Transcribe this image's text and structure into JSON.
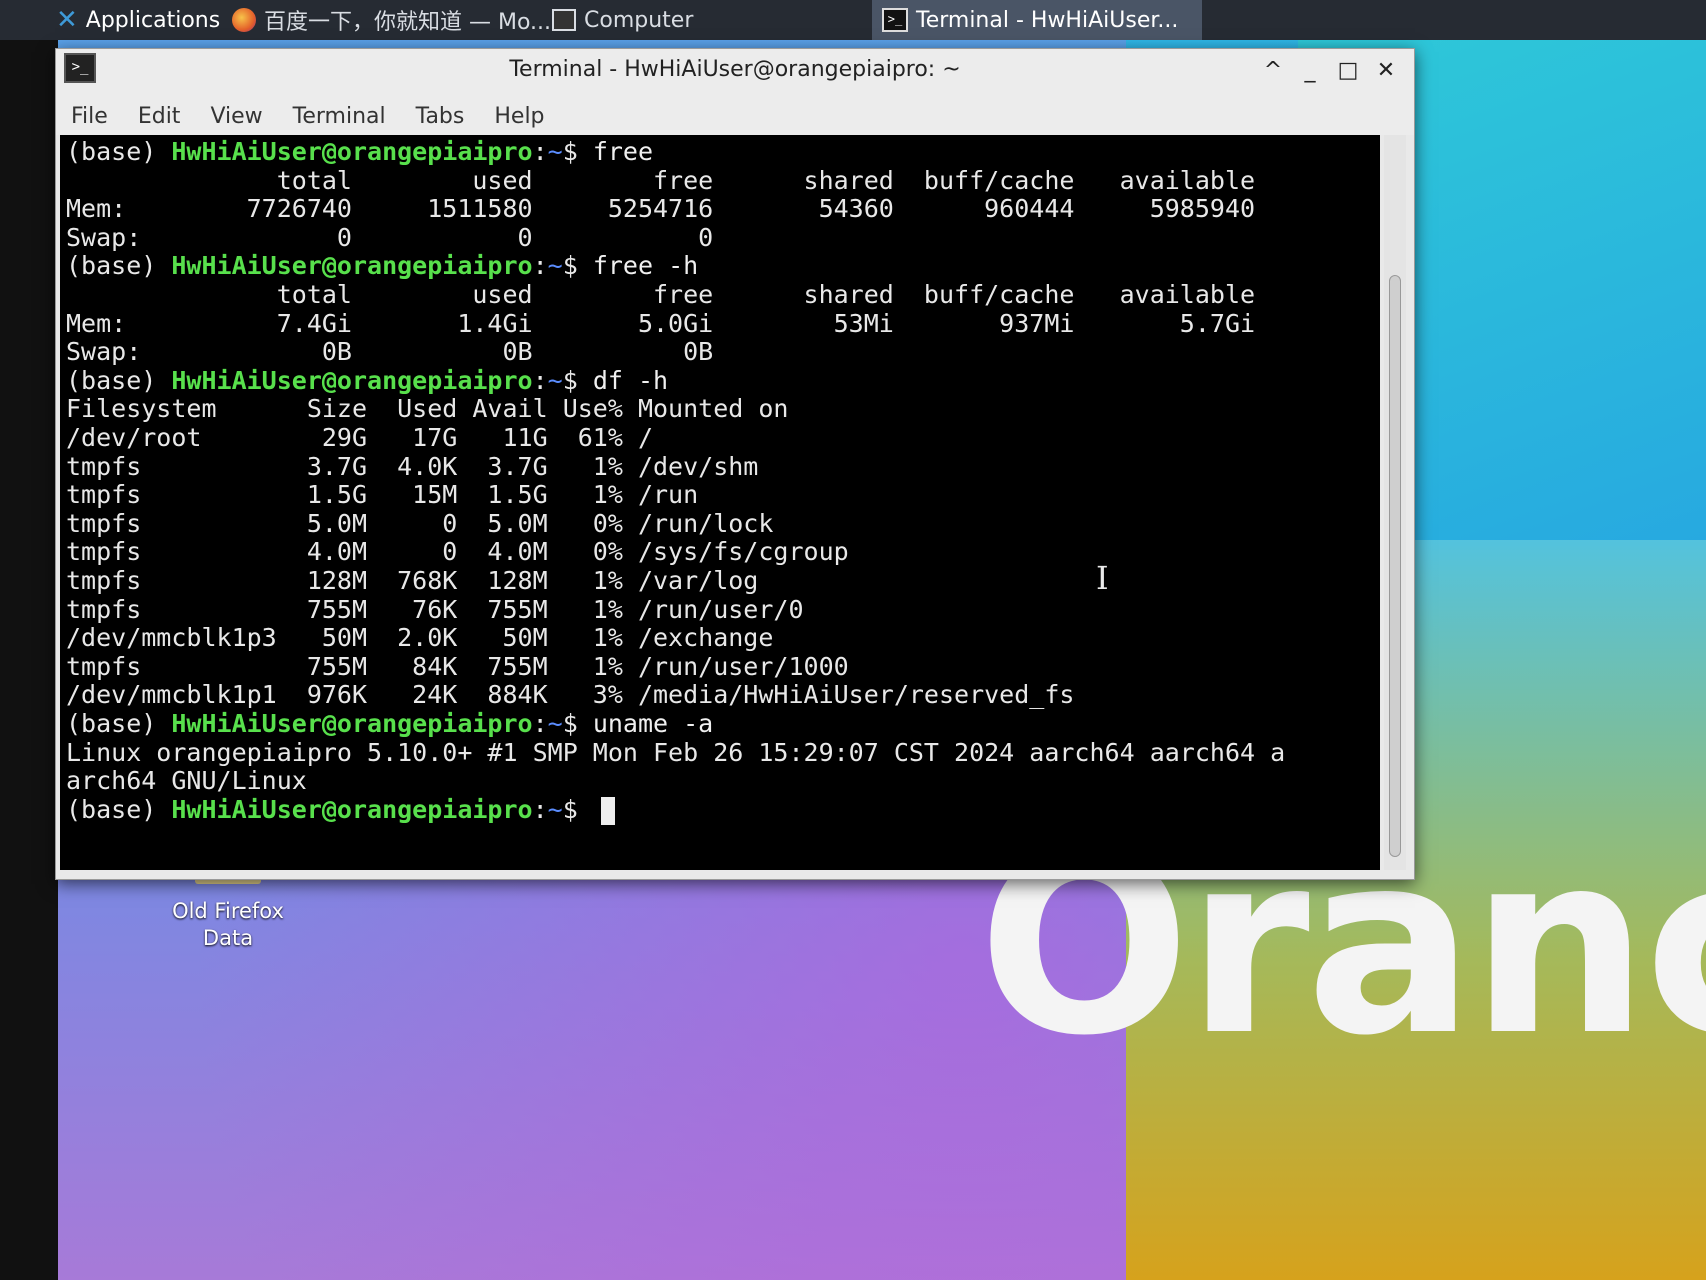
{
  "taskbar": {
    "applications_label": "Applications",
    "firefox_label": "百度一下，你就知道 — Mo...",
    "computer_label": "Computer",
    "terminal_label": "Terminal - HwHiAiUser..."
  },
  "window": {
    "title": "Terminal - HwHiAiUser@orangepiaipro: ~",
    "controls": {
      "up": "^",
      "minimize": "_",
      "maximize": "□",
      "close": "✕"
    }
  },
  "menu": [
    "File",
    "Edit",
    "View",
    "Terminal",
    "Tabs",
    "Help"
  ],
  "prompt": {
    "env": "(base) ",
    "userhost": "HwHiAiUser@orangepiaipro",
    "sep": ":",
    "path": "~",
    "dollar": "$ "
  },
  "terminal": {
    "lines": [
      {
        "type": "prompt",
        "cmd": "free"
      },
      {
        "type": "out",
        "text": "              total        used        free      shared  buff/cache   available"
      },
      {
        "type": "out",
        "text": "Mem:        7726740     1511580     5254716       54360      960444     5985940"
      },
      {
        "type": "out",
        "text": "Swap:             0           0           0"
      },
      {
        "type": "prompt",
        "cmd": "free -h"
      },
      {
        "type": "out",
        "text": "              total        used        free      shared  buff/cache   available"
      },
      {
        "type": "out",
        "text": "Mem:          7.4Gi       1.4Gi       5.0Gi        53Mi       937Mi       5.7Gi"
      },
      {
        "type": "out",
        "text": "Swap:            0B          0B          0B"
      },
      {
        "type": "prompt",
        "cmd": "df -h"
      },
      {
        "type": "out",
        "text": "Filesystem      Size  Used Avail Use% Mounted on"
      },
      {
        "type": "out",
        "text": "/dev/root        29G   17G   11G  61% /"
      },
      {
        "type": "out",
        "text": "tmpfs           3.7G  4.0K  3.7G   1% /dev/shm"
      },
      {
        "type": "out",
        "text": "tmpfs           1.5G   15M  1.5G   1% /run"
      },
      {
        "type": "out",
        "text": "tmpfs           5.0M     0  5.0M   0% /run/lock"
      },
      {
        "type": "out",
        "text": "tmpfs           4.0M     0  4.0M   0% /sys/fs/cgroup"
      },
      {
        "type": "out",
        "text": "tmpfs           128M  768K  128M   1% /var/log"
      },
      {
        "type": "out",
        "text": "tmpfs           755M   76K  755M   1% /run/user/0"
      },
      {
        "type": "out",
        "text": "/dev/mmcblk1p3   50M  2.0K   50M   1% /exchange"
      },
      {
        "type": "out",
        "text": "tmpfs           755M   84K  755M   1% /run/user/1000"
      },
      {
        "type": "out",
        "text": "/dev/mmcblk1p1  976K   24K  884K   3% /media/HwHiAiUser/reserved_fs"
      },
      {
        "type": "prompt",
        "cmd": "uname -a"
      },
      {
        "type": "out",
        "text": "Linux orangepiaipro 5.10.0+ #1 SMP Mon Feb 26 15:29:07 CST 2024 aarch64 aarch64 a"
      },
      {
        "type": "out",
        "text": "arch64 GNU/Linux"
      },
      {
        "type": "prompt",
        "cmd": "",
        "cursor": true
      }
    ]
  },
  "desktop": {
    "icon_label_line1": "Old Firefox",
    "icon_label_line2": "Data",
    "wallpaper_brand_text": "Oranc"
  },
  "colors": {
    "prompt_userhost": "#58e04c",
    "prompt_path": "#5b8dff",
    "terminal_bg": "#000000",
    "taskbar_bg": "#262b33"
  }
}
